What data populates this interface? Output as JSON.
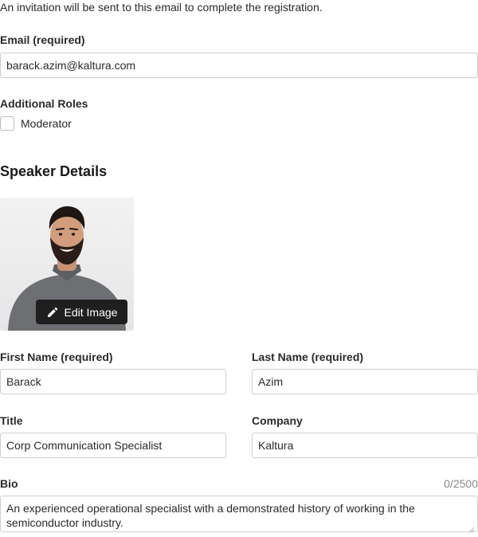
{
  "intro_text": "An invitation will be sent to this email to complete the registration.",
  "email": {
    "label": "Email (required)",
    "value": "barack.azim@kaltura.com"
  },
  "additional_roles": {
    "label": "Additional Roles",
    "options": [
      {
        "label": "Moderator",
        "checked": false
      }
    ]
  },
  "speaker_details": {
    "title": "Speaker Details",
    "edit_image_label": "Edit Image",
    "edit_icon": "pencil-icon"
  },
  "first_name": {
    "label": "First Name (required)",
    "value": "Barack"
  },
  "last_name": {
    "label": "Last Name (required)",
    "value": "Azim"
  },
  "title_field": {
    "label": "Title",
    "value": "Corp Communication Specialist"
  },
  "company": {
    "label": "Company",
    "value": "Kaltura"
  },
  "bio": {
    "label": "Bio",
    "counter": "0/2500",
    "value": "An experienced operational specialist with a demonstrated history of working in the semiconductor industry."
  },
  "colors": {
    "edit_button_bg": "#1f1f1f",
    "input_border": "#cfcfcf",
    "text": "#2a2a2a"
  }
}
